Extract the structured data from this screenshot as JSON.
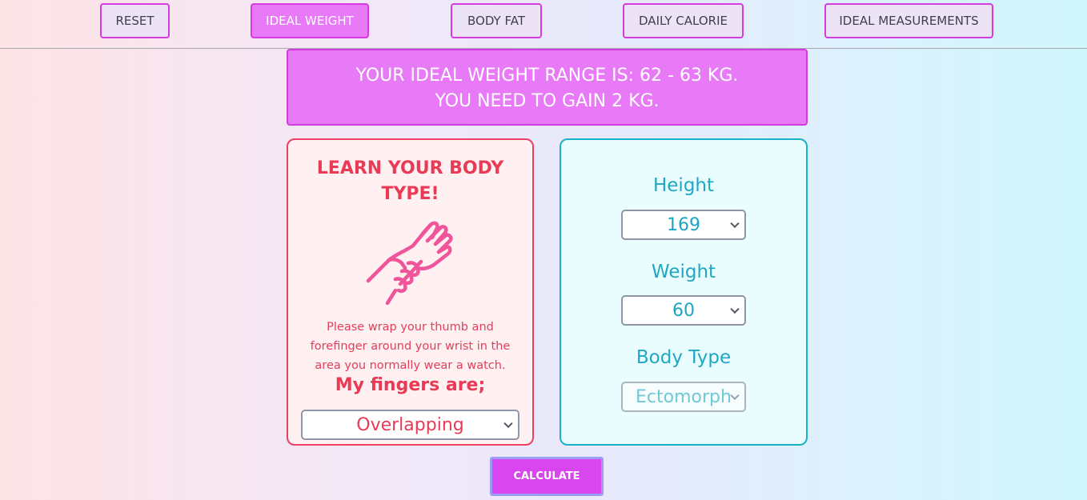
{
  "nav": {
    "reset": "RESET",
    "ideal_weight": "IDEAL WEIGHT",
    "body_fat": "BODY FAT",
    "daily_calorie": "DAILY CALORIE",
    "ideal_measurements": "IDEAL MEASUREMENTS",
    "active_tab": "ideal_weight"
  },
  "result": {
    "line1": "YOUR IDEAL WEIGHT RANGE IS: 62 - 63 KG.",
    "line2": "YOU NEED TO GAIN 2 KG."
  },
  "body_type_panel": {
    "title": "LEARN YOUR BODY TYPE!",
    "icon": "wrist-hand-icon",
    "instructions": "Please wrap your thumb and forefinger around your wrist in the area you normally wear a watch.",
    "fingers_label": "My fingers are;",
    "fingers_value": "Overlapping"
  },
  "measurements_panel": {
    "height_label": "Height",
    "height_value": "169",
    "weight_label": "Weight",
    "weight_value": "60",
    "body_type_label": "Body Type",
    "body_type_value": "Ectomorph"
  },
  "calculate_label": "CALCULATE",
  "colors": {
    "accent_pink": "#e879f7",
    "accent_magenta": "#d946ef",
    "red": "#e93a56",
    "teal": "#1fa8c3"
  }
}
